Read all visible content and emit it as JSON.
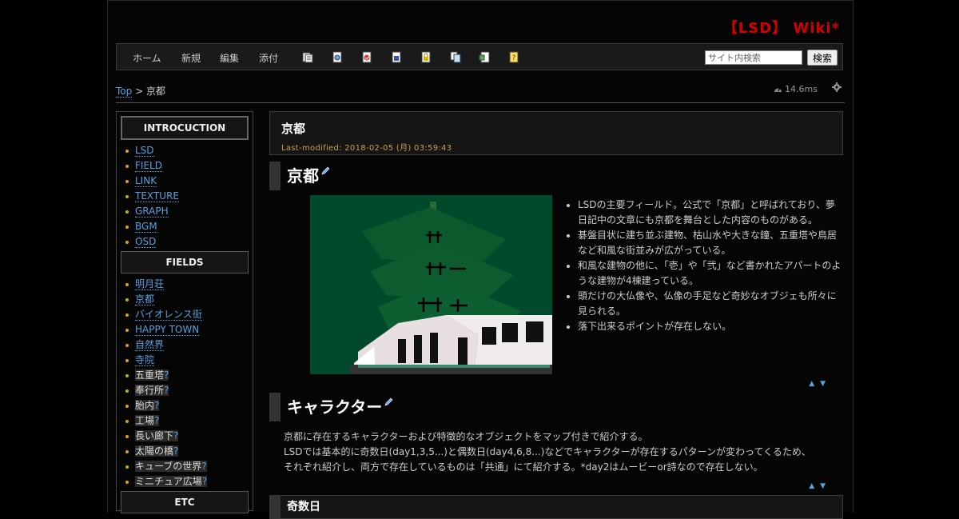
{
  "site": {
    "title": "【LSD】 Wiki*"
  },
  "nav": {
    "links": [
      "ホーム",
      "新規",
      "編集",
      "添付"
    ],
    "tool_icons": [
      "list-icon",
      "search-doc-icon",
      "recent-icon",
      "backup-icon",
      "lock-icon",
      "copy-icon",
      "rename-icon",
      "help-icon"
    ],
    "search_placeholder": "サイト内検索",
    "search_button": "検索"
  },
  "breadcrumb": {
    "top": "Top",
    "separator": ">",
    "current": "京都"
  },
  "status": {
    "timing": "14.6ms"
  },
  "sidebar": {
    "sections": [
      {
        "heading": "INTROCUCTION",
        "items": [
          {
            "label": "LSD",
            "missing": false
          },
          {
            "label": "FIELD",
            "missing": false
          },
          {
            "label": "LINK",
            "missing": false
          },
          {
            "label": "TEXTURE",
            "missing": false
          },
          {
            "label": "GRAPH",
            "missing": false
          },
          {
            "label": "BGM",
            "missing": false
          },
          {
            "label": "OSD",
            "missing": false
          }
        ]
      },
      {
        "heading": "FIELDS",
        "items": [
          {
            "label": "明月荘",
            "missing": false
          },
          {
            "label": "京都",
            "missing": false
          },
          {
            "label": "バイオレンス街",
            "missing": false
          },
          {
            "label": "HAPPY TOWN",
            "missing": false
          },
          {
            "label": "自然界",
            "missing": false
          },
          {
            "label": "寺院",
            "missing": false
          },
          {
            "label": "五重塔",
            "missing": true
          },
          {
            "label": "奉行所",
            "missing": true
          },
          {
            "label": "胎内",
            "missing": true
          },
          {
            "label": "工場",
            "missing": true
          },
          {
            "label": "長い廊下",
            "missing": true
          },
          {
            "label": "太陽の橋",
            "missing": true
          },
          {
            "label": "キューブの世界",
            "missing": true
          },
          {
            "label": "ミニチュア広場",
            "missing": true
          }
        ]
      },
      {
        "heading": "ETC",
        "items": []
      }
    ]
  },
  "page": {
    "title": "京都",
    "last_modified": "Last-modified: 2018-02-05 (月) 03:59:43",
    "section1": {
      "heading": "京都",
      "bullets": [
        "LSDの主要フィールド。公式で「京都」と呼ばれており、夢日記中の文章にも京都を舞台とした内容のものがある。",
        "碁盤目状に建ち並ぶ建物、枯山水や大きな鐘、五重塔や鳥居など和風な街並みが広がっている。",
        "和風な建物の他に、「壱」や「弐」など書かれたアパートのような建物が4棟建っている。",
        "頭だけの大仏像や、仏像の手足など奇妙なオブジェも所々に見られる。",
        "落下出来るポイントが存在しない。"
      ]
    },
    "section2": {
      "heading": "キャラクター",
      "lines": [
        "京都に存在するキャラクターおよび特徴的なオブジェクトをマップ付きで紹介する。",
        "LSDでは基本的に奇数日(day1,3,5...)と偶数日(day4,6,8...)などでキャラクターが存在するパターンが変わってくるため、",
        "それぞれ紹介し、両方で存在しているものは「共通」にて紹介する。*day2はムービーor詩なので存在しない。"
      ]
    },
    "section3": {
      "heading": "奇数日"
    },
    "updown": "▲ ▼"
  }
}
